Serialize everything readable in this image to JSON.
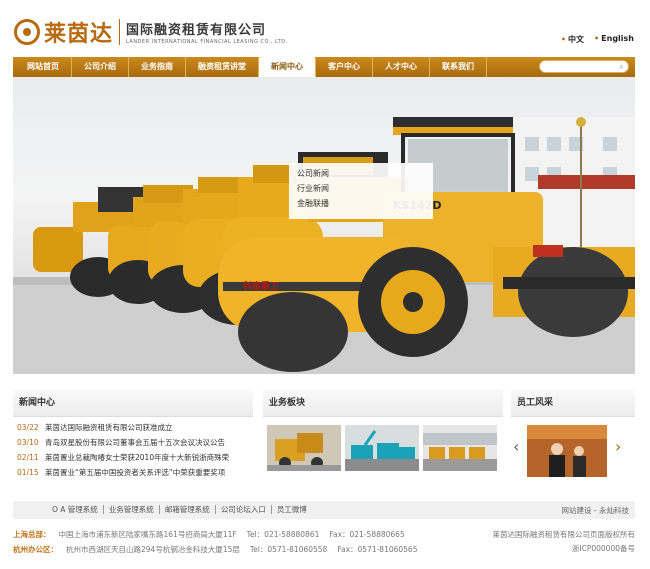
{
  "header": {
    "logo_cn": "莱茵达",
    "company_cn": "国际融资租赁有限公司",
    "company_en": "LANDER INTERNATIONAL FINANCIAL LEASING CO., LTD.",
    "lang": [
      "中文",
      "English"
    ]
  },
  "nav": {
    "items": [
      "网站首页",
      "公司介绍",
      "业务指南",
      "融资租赁讲堂",
      "新闻中心",
      "客户中心",
      "人才中心",
      "联系我们"
    ],
    "active_index": 4
  },
  "submenu": [
    "公司新闻",
    "行业新闻",
    "金融联播"
  ],
  "hero": {
    "roller_label": "KS142D",
    "brand_text": "科泰重工"
  },
  "news": {
    "title": "新闻中心",
    "items": [
      {
        "date": "03/22",
        "text": "莱茵达国际融资租赁有限公司获准成立"
      },
      {
        "date": "03/10",
        "text": "青岛双星股份有限公司董事会五届十五次会议决议公告"
      },
      {
        "date": "02/11",
        "text": "莱茵置业总裁陶椿女士荣获2010年度十大新锐浙商殊荣"
      },
      {
        "date": "01/15",
        "text": "莱茵置业“第五届中国投资者关系评选”中荣获重要奖项"
      }
    ]
  },
  "business": {
    "title": "业务板块"
  },
  "staff": {
    "title": "员工风采"
  },
  "footer": {
    "links": [
      "O A 管理系统",
      "业务管理系统",
      "邮箱管理系统",
      "公司论坛入口",
      "员工微博"
    ],
    "credit": "网站建设 - 永灿科技",
    "offices": [
      {
        "label": "上海总部：",
        "address": "中国上海市浦东新区陆家嘴东路161号招商局大厦11F",
        "tel": "Tel：021-58880861",
        "fax": "Fax：021-58880665"
      },
      {
        "label": "杭州办公区：",
        "address": "杭州市西湖区天目山路294号杭钢冶金科技大厦15层",
        "tel": "Tel：0571-81060558",
        "fax": "Fax：0571-81060565"
      }
    ],
    "copyright": "莱茵达国际融资租赁有限公司页面版权所有",
    "icp": "浙ICP000000备号"
  },
  "colors": {
    "brand": "#b86a12",
    "nav": "#b97a14"
  }
}
